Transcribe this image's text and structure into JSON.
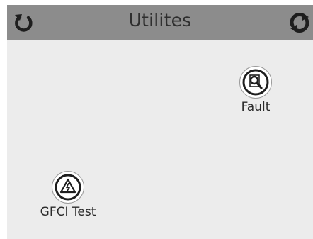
{
  "header": {
    "title": "Utilites",
    "back_icon": "back-arrow-icon",
    "refresh_icon": "refresh-icon"
  },
  "utilities": {
    "fault": {
      "label": "Fault",
      "icon": "magnifier-icon"
    },
    "gfci_test": {
      "label": "GFCI Test",
      "icon": "warning-triangle-icon"
    }
  },
  "colors": {
    "header_bg": "#8c8c8c",
    "screen_bg": "#ececec",
    "icon_dark": "#1e1e1e",
    "text": "#2a2a2a"
  }
}
